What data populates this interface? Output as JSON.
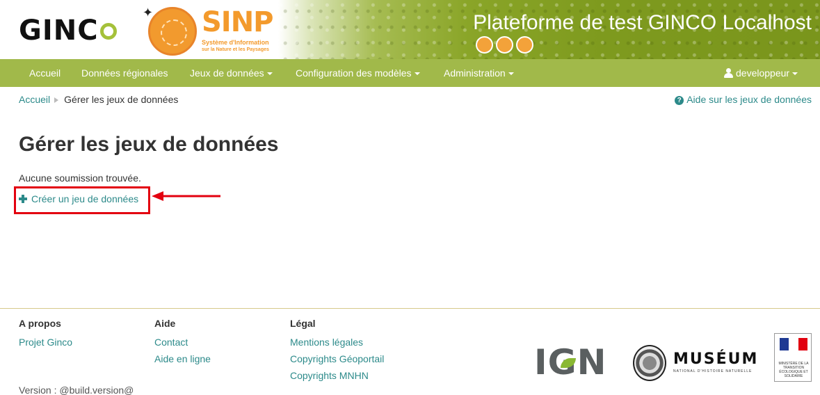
{
  "header": {
    "logo_text": "GINC",
    "logo_o": "O",
    "sinp_title": "SINP",
    "sinp_subtitle": "Système d'Information",
    "sinp_subtitle2": "sur la Nature et les Paysages",
    "platform_title": "Plateforme de test GINCO Localhost"
  },
  "nav": {
    "items": [
      {
        "label": "Accueil",
        "dropdown": false
      },
      {
        "label": "Données régionales",
        "dropdown": false
      },
      {
        "label": "Jeux de données",
        "dropdown": true
      },
      {
        "label": "Configuration des modèles",
        "dropdown": true
      },
      {
        "label": "Administration",
        "dropdown": true
      }
    ],
    "user": "developpeur"
  },
  "breadcrumb": {
    "home": "Accueil",
    "current": "Gérer les jeux de données"
  },
  "help_link": "Aide sur les jeux de données",
  "main": {
    "title": "Gérer les jeux de données",
    "empty_message": "Aucune soumission trouvée.",
    "create_link": "Créer un jeu de données"
  },
  "annotation": {
    "highlight_color": "#e3000f"
  },
  "footer": {
    "columns": [
      {
        "heading": "A propos",
        "links": [
          "Projet Ginco"
        ]
      },
      {
        "heading": "Aide",
        "links": [
          "Contact",
          "Aide en ligne"
        ]
      },
      {
        "heading": "Légal",
        "links": [
          "Mentions légales",
          "Copyrights Géoportail",
          "Copyrights MNHN"
        ]
      }
    ],
    "version": "Version : @build.version@",
    "logos": {
      "ign": "IGN",
      "museum": "MUSÉUM",
      "museum_sub": "NATIONAL D'HISTOIRE NATURELLE",
      "ministry": "MINISTÈRE DE LA TRANSITION ÉCOLOGIQUE ET SOLIDAIRE"
    }
  },
  "colors": {
    "navbar": "#a1b94a",
    "link": "#2c8a8a",
    "accent_orange": "#f39a2c"
  }
}
